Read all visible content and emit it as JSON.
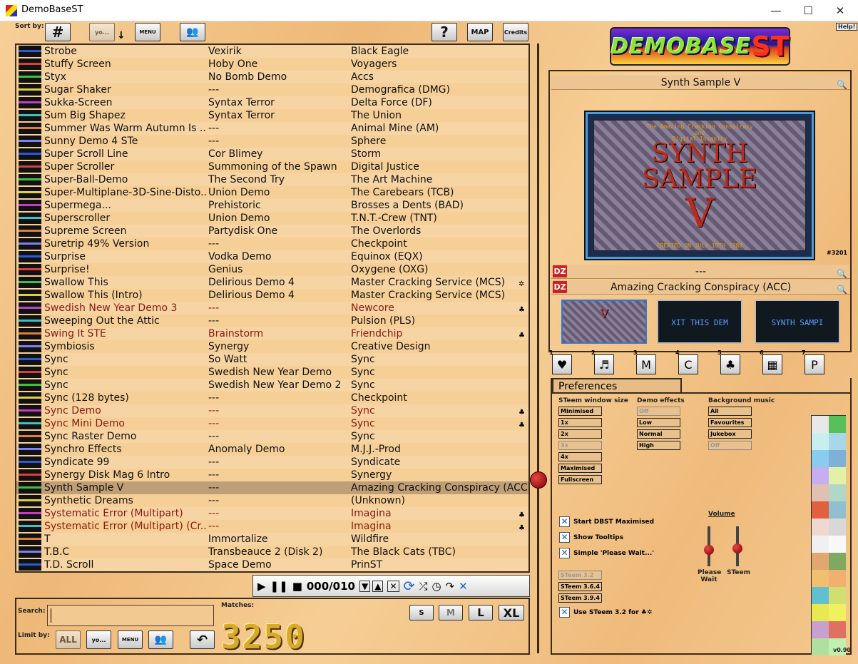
{
  "window": {
    "title": "DemoBaseST",
    "min": "—",
    "max": "☐",
    "close": "✕"
  },
  "toolbar": {
    "sort_by": "Sort by:",
    "help_label": "Help!",
    "credits_label": "Credits",
    "map_label": "MAP",
    "question": "?",
    "hash": "#",
    "menu_label": "MENU",
    "yo_label": "yo..."
  },
  "logo": {
    "text": "DEMOBASE",
    "st": "ST"
  },
  "rows": [
    {
      "title": "Strobe",
      "group1": "Vexirik",
      "group2": "Black Eagle",
      "red": false,
      "icon": ""
    },
    {
      "title": "Stuffy Screen",
      "group1": "Hoby One",
      "group2": "Voyagers",
      "red": false,
      "icon": ""
    },
    {
      "title": "Styx",
      "group1": "No Bomb Demo",
      "group2": "Accs",
      "red": false,
      "icon": ""
    },
    {
      "title": "Sugar Shaker",
      "group1": "---",
      "group2": "Demografica (DMG)",
      "red": false,
      "icon": ""
    },
    {
      "title": "Sukka-Screen",
      "group1": "Syntax Terror",
      "group2": "Delta Force (DF)",
      "red": false,
      "icon": ""
    },
    {
      "title": "Sum Big Shapez",
      "group1": "Syntax Terror",
      "group2": "The Union",
      "red": false,
      "icon": ""
    },
    {
      "title": "Summer Was Warm Autumn Is ...",
      "group1": "---",
      "group2": "Animal Mine (AM)",
      "red": false,
      "icon": ""
    },
    {
      "title": "Sunny Demo 4 STe",
      "group1": "---",
      "group2": "Sphere",
      "red": false,
      "icon": ""
    },
    {
      "title": "Super Scroll Line",
      "group1": "Cor Blimey",
      "group2": "Storm",
      "red": false,
      "icon": ""
    },
    {
      "title": "Super Scroller",
      "group1": "Summoning of the Spawn",
      "group2": "Digital Justice",
      "red": false,
      "icon": ""
    },
    {
      "title": "Super-Ball-Demo",
      "group1": "The Second Try",
      "group2": "The Art Machine",
      "red": false,
      "icon": ""
    },
    {
      "title": "Super-Multiplane-3D-Sine-Disto...",
      "group1": "Union Demo",
      "group2": "The Carebears (TCB)",
      "red": false,
      "icon": ""
    },
    {
      "title": "Supermega...",
      "group1": "Prehistoric",
      "group2": "Brosses a Dents (BAD)",
      "red": false,
      "icon": ""
    },
    {
      "title": "Superscroller",
      "group1": "Union Demo",
      "group2": "T.N.T.-Crew (TNT)",
      "red": false,
      "icon": ""
    },
    {
      "title": "Supreme Screen",
      "group1": "Partydisk One",
      "group2": "The Overlords",
      "red": false,
      "icon": ""
    },
    {
      "title": "Suretrip 49% Version",
      "group1": "---",
      "group2": "Checkpoint",
      "red": false,
      "icon": ""
    },
    {
      "title": "Surprise",
      "group1": "Vodka Demo",
      "group2": "Equinox (EQX)",
      "red": false,
      "icon": ""
    },
    {
      "title": "Surprise!",
      "group1": "Genius",
      "group2": "Oxygene (OXG)",
      "red": false,
      "icon": ""
    },
    {
      "title": "Swallow This",
      "group1": "Delirious Demo 4",
      "group2": "Master Cracking Service (MCS)",
      "red": false,
      "icon": "✲"
    },
    {
      "title": "Swallow This (Intro)",
      "group1": "Delirious Demo 4",
      "group2": "Master Cracking Service (MCS)",
      "red": false,
      "icon": ""
    },
    {
      "title": "Swedish New Year Demo 3",
      "group1": "---",
      "group2": "Newcore",
      "red": true,
      "icon": "♣"
    },
    {
      "title": "Sweeping Out the Attic",
      "group1": "---",
      "group2": "Pulsion (PLS)",
      "red": false,
      "icon": ""
    },
    {
      "title": "Swing It STE",
      "group1": "Brainstorm",
      "group2": "Friendchip",
      "red": true,
      "icon": "♣"
    },
    {
      "title": "Symbiosis",
      "group1": "Synergy",
      "group2": "Creative Design",
      "red": false,
      "icon": ""
    },
    {
      "title": "Sync",
      "group1": "So Watt",
      "group2": "Sync",
      "red": false,
      "icon": ""
    },
    {
      "title": "Sync",
      "group1": "Swedish New Year Demo",
      "group2": "Sync",
      "red": false,
      "icon": ""
    },
    {
      "title": "Sync",
      "group1": "Swedish New Year Demo 2",
      "group2": "Sync",
      "red": false,
      "icon": ""
    },
    {
      "title": "Sync (128 bytes)",
      "group1": "---",
      "group2": "Checkpoint",
      "red": false,
      "icon": ""
    },
    {
      "title": "Sync Demo",
      "group1": "---",
      "group2": "Sync",
      "red": true,
      "icon": "♣"
    },
    {
      "title": "Sync Mini Demo",
      "group1": "---",
      "group2": "Sync",
      "red": true,
      "icon": "♣"
    },
    {
      "title": "Sync Raster Demo",
      "group1": "---",
      "group2": "Sync",
      "red": false,
      "icon": ""
    },
    {
      "title": "Synchro Effects",
      "group1": "Anomaly Demo",
      "group2": "M.J.J.-Prod",
      "red": false,
      "icon": ""
    },
    {
      "title": "Syndicate 99",
      "group1": "---",
      "group2": "Syndicate",
      "red": false,
      "icon": ""
    },
    {
      "title": "Synergy Disk Mag 6 Intro",
      "group1": "---",
      "group2": "Synergy",
      "red": false,
      "icon": ""
    },
    {
      "title": "Synth Sample V",
      "group1": "---",
      "group2": "Amazing Cracking Conspiracy (ACC)...",
      "red": false,
      "icon": "",
      "sel": true
    },
    {
      "title": "Synthetic Dreams",
      "group1": "---",
      "group2": "(Unknown)",
      "red": false,
      "icon": ""
    },
    {
      "title": "Systematic Error (Multipart)",
      "group1": "---",
      "group2": "Imagina",
      "red": true,
      "icon": "♣"
    },
    {
      "title": "Systematic Error (Multipart) (Cr...",
      "group1": "---",
      "group2": "Imagina",
      "red": true,
      "icon": "♣"
    },
    {
      "title": "T",
      "group1": "Immortalize",
      "group2": "Wildfire",
      "red": false,
      "icon": ""
    },
    {
      "title": "T.B.C",
      "group1": "Transbeauce 2 (Disk 2)",
      "group2": "The Black Cats (TBC)",
      "red": false,
      "icon": ""
    },
    {
      "title": "T.D. Scroll",
      "group1": "Space Demo",
      "group2": "PrinST",
      "red": false,
      "icon": ""
    }
  ],
  "player": {
    "counter": "000/010"
  },
  "bottom": {
    "search_label": "Search:",
    "matches_label": "Matches:",
    "matches": "3250",
    "limit_label": "Limit by:",
    "all_label": "ALL",
    "sizes": [
      "S",
      "M",
      "L",
      "XL"
    ]
  },
  "detail": {
    "title": "Synth Sample V",
    "number": "#3201",
    "bar2": "---",
    "group": "Amazing Cracking Conspiracy (ACC)",
    "dz": "DZ",
    "screen_top1": "The Amazing Cracking Conspiracy",
    "screen_top2": "and",
    "screen_top3": "Digital Insanity",
    "screen_big1": "SYNTH",
    "screen_big2": "SAMPLE",
    "screen_big3": "V",
    "screen_bottom": "CREATED ON JULY 10TH 1988",
    "mini2": "XIT THIS DEM",
    "mini3": "SYNTH SAMPI"
  },
  "tabs": [
    {
      "n": "1",
      "icon": "♥"
    },
    {
      "n": "2",
      "icon": "♬"
    },
    {
      "n": "3",
      "icon": "M"
    },
    {
      "n": "4",
      "icon": "C"
    },
    {
      "n": "5",
      "icon": "♣"
    },
    {
      "n": "6",
      "icon": "▦"
    },
    {
      "n": "7",
      "icon": "P"
    }
  ],
  "prefs": {
    "title": "Preferences",
    "h_window": "STeem window size",
    "h_effects": "Demo effects",
    "h_music": "Background music",
    "window_opts": [
      "Minimised",
      "1x",
      "2x",
      "3x",
      "4x",
      "Maximised",
      "Fullscreen"
    ],
    "effect_opts": [
      "Off",
      "Low",
      "Normal",
      "High"
    ],
    "music_opts": [
      "All",
      "Favourites",
      "Jukebox",
      "Off"
    ],
    "start_max": "Start DBST Maximised",
    "tooltips": "Show Tooltips",
    "simple_wait": "Simple 'Please Wait...'",
    "volume": "Volume",
    "please_wait": "Please\nWait",
    "steem": "STeem",
    "versions": [
      "STeem 3.2",
      "STeem 3.6.4",
      "STeem 3.9.4"
    ],
    "use32": "Use STeem 3.2 for",
    "version": "v0.90"
  },
  "swatch_colors": [
    "#e8e8e8",
    "#58c058",
    "#c9eef0",
    "#a8d8e8",
    "#88ccee",
    "#7fb0d8",
    "#c6aef0",
    "#e2f0a8",
    "#e0c0b0",
    "#b0d8c8",
    "#e06040",
    "#90c0d0",
    "#f0d8d0",
    "#d8d8d8",
    "#f0f0f0",
    "#f8f8f8",
    "#e0a870",
    "#80a860",
    "#f0c070",
    "#f0b070",
    "#60c0d0",
    "#d0e070",
    "#e8e850",
    "#f0f060",
    "#c8a0d0",
    "#e07060",
    "#b0e0a0",
    "#c0f0b0"
  ]
}
